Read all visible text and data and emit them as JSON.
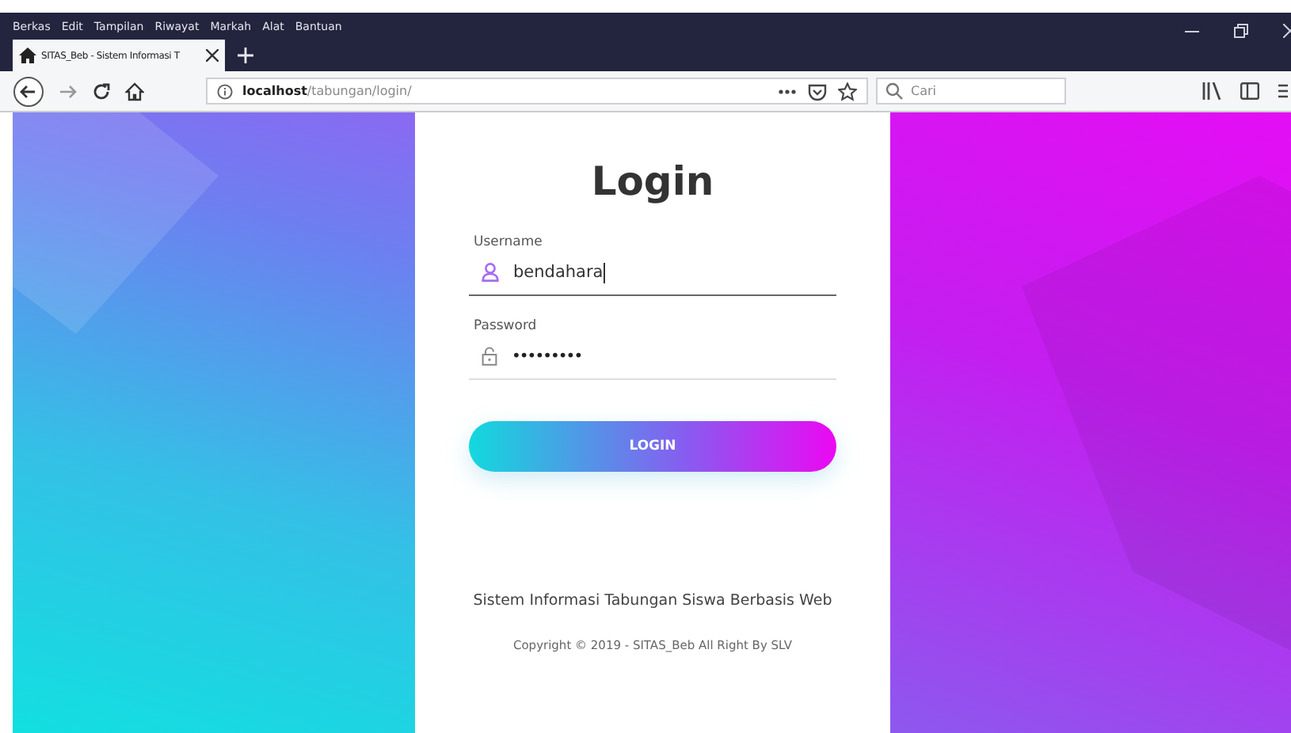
{
  "window": {
    "menu": [
      "Berkas",
      "Edit",
      "Tampilan",
      "Riwayat",
      "Markah",
      "Alat",
      "Bantuan"
    ]
  },
  "tabs": [
    {
      "title": "SITAS_Beb - Sistem Informasi T",
      "selected": true
    }
  ],
  "address_bar": {
    "url": "**localhost**/tabungan/login/"
  },
  "search": {
    "placeholder": "Cari"
  },
  "login": {
    "title": "Login",
    "fields": [
      {
        "kind": "text",
        "label": "Username",
        "value": "bendahara",
        "focused": true
      },
      {
        "kind": "password",
        "label": "Password",
        "value": "•••••••••",
        "focused": false
      }
    ],
    "button": "LOGIN",
    "footer": "Sistem Informasi Tabungan Siswa Berbasis Web",
    "copyright": "Copyright © 2019 - SITAS_Beb All Right By SLV"
  }
}
